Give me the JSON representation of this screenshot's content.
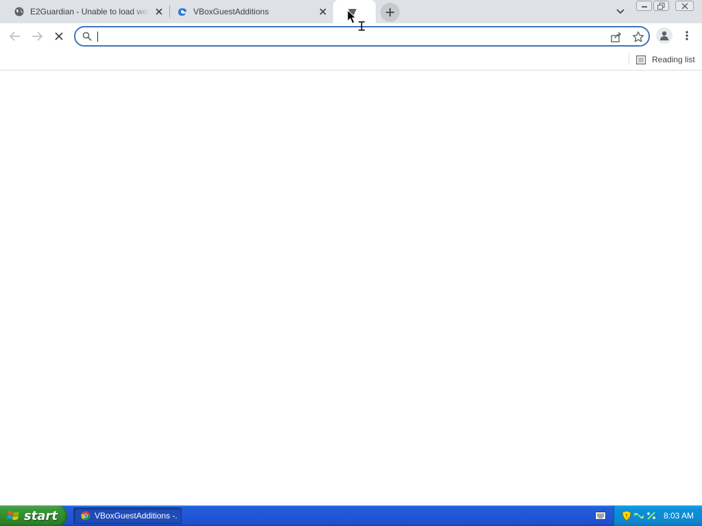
{
  "browser": {
    "tabs": [
      {
        "title": "E2Guardian - Unable to load website",
        "favicon": "globe-icon",
        "state": "inactive"
      },
      {
        "title": "VBoxGuestAdditions",
        "favicon": "edge-icon",
        "state": "inactive"
      },
      {
        "title": "",
        "favicon": "loading-spinner-icon",
        "state": "active"
      }
    ],
    "new_tab_icon": "plus-icon",
    "tab_search_icon": "chevron-down-icon",
    "omnibox": {
      "value": "",
      "placeholder": "",
      "focused": true
    },
    "bookmarks_bar": {
      "reading_list_label": "Reading list"
    },
    "colors": {
      "tab_strip": "#dee1e6",
      "focus_ring": "#3b73b9",
      "page_bg": "#ffffff"
    }
  },
  "taskbar": {
    "start_label": "start",
    "items": [
      {
        "label": "VBoxGuestAdditions -..."
      }
    ],
    "clock": "8:03 AM",
    "colors": {
      "bar": "#245edb",
      "start": "#3c9a38",
      "tray": "#0f8fd9"
    }
  }
}
